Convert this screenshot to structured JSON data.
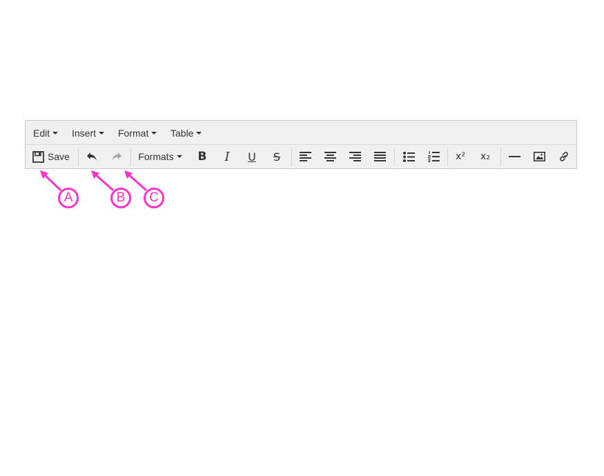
{
  "menubar": {
    "items": [
      {
        "label": "Edit"
      },
      {
        "label": "Insert"
      },
      {
        "label": "Format"
      },
      {
        "label": "Table"
      }
    ]
  },
  "toolbar": {
    "save_label": "Save",
    "formats_label": "Formats",
    "bold_label": "B",
    "italic_label": "I",
    "underline_label": "U",
    "strikethrough_label": "S",
    "superscript_label": "x²",
    "subscript_label": "x₂",
    "redo_state": "disabled"
  },
  "annotations": {
    "color": "#ff33cc",
    "callouts": [
      {
        "label": "A"
      },
      {
        "label": "B"
      },
      {
        "label": "C"
      }
    ]
  },
  "icons": [
    "save-icon",
    "undo-icon",
    "redo-icon",
    "align-left-icon",
    "align-center-icon",
    "align-right-icon",
    "align-justify-icon",
    "bullet-list-icon",
    "numbered-list-icon",
    "horizontal-rule-icon",
    "image-icon",
    "link-icon"
  ]
}
